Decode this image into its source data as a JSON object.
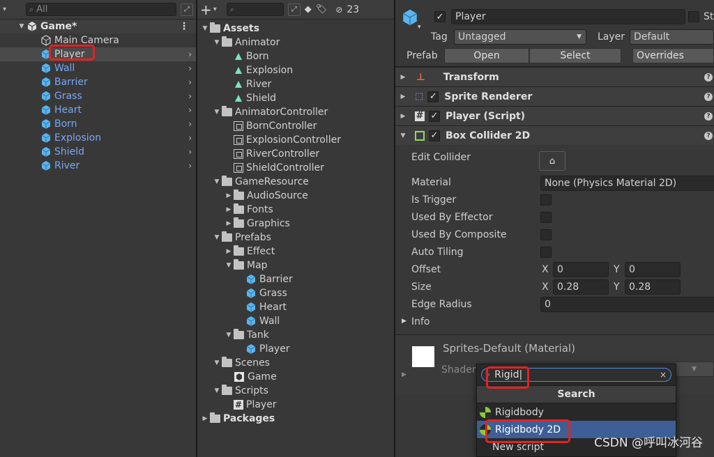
{
  "hierarchy": {
    "search_placeholder": "All",
    "scene_name": "Game*",
    "items": [
      {
        "label": "Main Camera",
        "prefab": false,
        "selected": false
      },
      {
        "label": "Player",
        "prefab": true,
        "selected": true
      },
      {
        "label": "Wall",
        "prefab": true
      },
      {
        "label": "Barrier",
        "prefab": true
      },
      {
        "label": "Grass",
        "prefab": true
      },
      {
        "label": "Heart",
        "prefab": true
      },
      {
        "label": "Born",
        "prefab": true
      },
      {
        "label": "Explosion",
        "prefab": true
      },
      {
        "label": "Shield",
        "prefab": true
      },
      {
        "label": "River",
        "prefab": true
      }
    ]
  },
  "project": {
    "add_label": "+",
    "hidden_count": "23",
    "tree": [
      {
        "label": "Assets",
        "icon": "folder",
        "depth": 0,
        "open": true,
        "bold": true
      },
      {
        "label": "Animator",
        "icon": "folder",
        "depth": 1,
        "open": true
      },
      {
        "label": "Born",
        "icon": "anim",
        "depth": 2
      },
      {
        "label": "Explosion",
        "icon": "anim",
        "depth": 2
      },
      {
        "label": "River",
        "icon": "anim",
        "depth": 2
      },
      {
        "label": "Shield",
        "icon": "anim",
        "depth": 2
      },
      {
        "label": "AnimatorController",
        "icon": "folder",
        "depth": 1,
        "open": true
      },
      {
        "label": "BornController",
        "icon": "ctl",
        "depth": 2
      },
      {
        "label": "ExplosionController",
        "icon": "ctl",
        "depth": 2
      },
      {
        "label": "RiverController",
        "icon": "ctl",
        "depth": 2
      },
      {
        "label": "ShieldController",
        "icon": "ctl",
        "depth": 2
      },
      {
        "label": "GameResource",
        "icon": "folder",
        "depth": 1,
        "open": true
      },
      {
        "label": "AudioSource",
        "icon": "folder",
        "depth": 2,
        "open": false
      },
      {
        "label": "Fonts",
        "icon": "folder",
        "depth": 2,
        "open": false
      },
      {
        "label": "Graphics",
        "icon": "folder",
        "depth": 2,
        "open": false
      },
      {
        "label": "Prefabs",
        "icon": "folder",
        "depth": 1,
        "open": true
      },
      {
        "label": "Effect",
        "icon": "folder",
        "depth": 2,
        "open": false
      },
      {
        "label": "Map",
        "icon": "folder",
        "depth": 2,
        "open": true
      },
      {
        "label": "Barrier",
        "icon": "cube",
        "depth": 3
      },
      {
        "label": "Grass",
        "icon": "cube",
        "depth": 3
      },
      {
        "label": "Heart",
        "icon": "cube",
        "depth": 3
      },
      {
        "label": "Wall",
        "icon": "cube",
        "depth": 3
      },
      {
        "label": "Tank",
        "icon": "folder",
        "depth": 2,
        "open": true
      },
      {
        "label": "Player",
        "icon": "cube",
        "depth": 3
      },
      {
        "label": "Scenes",
        "icon": "folder",
        "depth": 1,
        "open": true
      },
      {
        "label": "Game",
        "icon": "scene",
        "depth": 2
      },
      {
        "label": "Scripts",
        "icon": "folder",
        "depth": 1,
        "open": true
      },
      {
        "label": "Player",
        "icon": "script",
        "depth": 2
      },
      {
        "label": "Packages",
        "icon": "folder",
        "depth": 0,
        "open": false,
        "bold": true
      }
    ]
  },
  "inspector": {
    "object_name": "Player",
    "static_label": "St",
    "tag_label": "Tag",
    "tag_value": "Untagged",
    "layer_label": "Layer",
    "layer_value": "Default",
    "prefab_label": "Prefab",
    "open_label": "Open",
    "select_label": "Select",
    "overrides_label": "Overrides",
    "components": {
      "transform": "Transform",
      "sprite_renderer": "Sprite Renderer",
      "player_script": "Player (Script)",
      "box_collider": "Box Collider 2D"
    },
    "props": {
      "edit_collider": "Edit Collider",
      "material": "Material",
      "material_value": "None (Physics Material 2D)",
      "is_trigger": "Is Trigger",
      "used_by_effector": "Used By Effector",
      "used_by_composite": "Used By Composite",
      "auto_tiling": "Auto Tiling",
      "offset": "Offset",
      "offset_x": "0",
      "offset_y": "0",
      "size": "Size",
      "size_x": "0.28",
      "size_y": "0.28",
      "edge_radius": "Edge Radius",
      "edge_radius_value": "0",
      "info": "Info",
      "x": "X",
      "y": "Y"
    },
    "material_name": "Sprites-Default (Material)",
    "shader_label": "Shader"
  },
  "add_component_popup": {
    "search_value": "Rigid",
    "header": "Search",
    "results": [
      "Rigidbody",
      "Rigidbody 2D",
      "New script"
    ],
    "active_index": 1
  },
  "watermark": "CSDN @呼叫冰河谷"
}
